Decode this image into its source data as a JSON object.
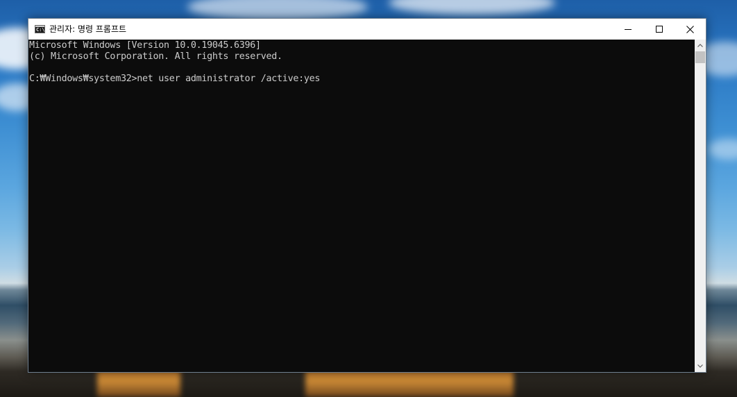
{
  "window": {
    "title": "관리자: 명령 프롬프트",
    "app_icon_glyph": "C:\\",
    "icons": {
      "app": "cmd-icon",
      "minimize": "minimize-icon",
      "maximize": "maximize-icon",
      "close": "close-icon",
      "scroll_up": "chevron-up-icon",
      "scroll_down": "chevron-down-icon"
    }
  },
  "console": {
    "lines": [
      "Microsoft Windows [Version 10.0.19045.6396]",
      "(c) Microsoft Corporation. All rights reserved.",
      "C:₩Windows₩system32>net user administrator /active:yes"
    ],
    "background_color": "#0c0c0c",
    "text_color": "#cccccc"
  }
}
